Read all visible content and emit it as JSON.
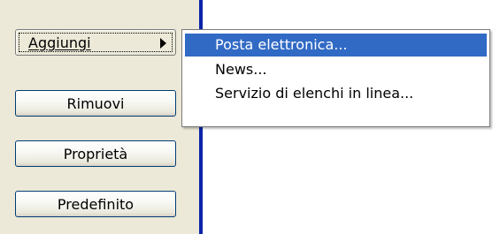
{
  "buttons": {
    "add_label": "Aggiungi",
    "remove_label": "Rimuovi",
    "properties_label": "Proprietà",
    "default_label": "Predefinito"
  },
  "menu": {
    "items": [
      {
        "label": "Posta elettronica...",
        "selected": true
      },
      {
        "label": "News...",
        "selected": false
      },
      {
        "label": "Servizio di elenchi in linea...",
        "selected": false
      }
    ]
  },
  "colors": {
    "panel_bg": "#ece9d8",
    "accent_blue": "#0a24a8",
    "selection": "#316ac5"
  }
}
